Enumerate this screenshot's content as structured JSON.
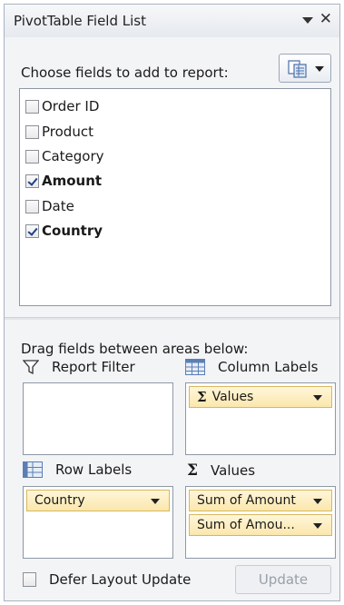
{
  "title_bar": {
    "title": "PivotTable Field List",
    "close_glyph": "✕"
  },
  "choose_label": "Choose fields to add to report:",
  "fields": [
    {
      "label": "Order ID",
      "checked": false
    },
    {
      "label": "Product",
      "checked": false
    },
    {
      "label": "Category",
      "checked": false
    },
    {
      "label": "Amount",
      "checked": true
    },
    {
      "label": "Date",
      "checked": false
    },
    {
      "label": "Country",
      "checked": true
    }
  ],
  "drag_label": "Drag fields between areas below:",
  "areas": {
    "report_filter": {
      "label": "Report Filter",
      "icon": "filter-icon",
      "items": []
    },
    "column_labels": {
      "label": "Column Labels",
      "icon": "grid-icon",
      "items": [
        {
          "label": "Σ Values"
        }
      ]
    },
    "row_labels": {
      "label": "Row Labels",
      "icon": "grid-icon",
      "items": [
        {
          "label": "Country"
        }
      ]
    },
    "values": {
      "label": "Values",
      "icon": "sigma-icon",
      "items": [
        {
          "label": "Sum of Amount"
        },
        {
          "label": "Sum of Amou..."
        }
      ]
    }
  },
  "footer": {
    "defer_label": "Defer Layout Update",
    "defer_checked": false,
    "update_label": "Update"
  },
  "colors": {
    "panel_bg": "#f3f4f6",
    "pill_bg": "#fbe7ad",
    "pill_border": "#d7b75e",
    "check_color": "#1e3f8a"
  }
}
